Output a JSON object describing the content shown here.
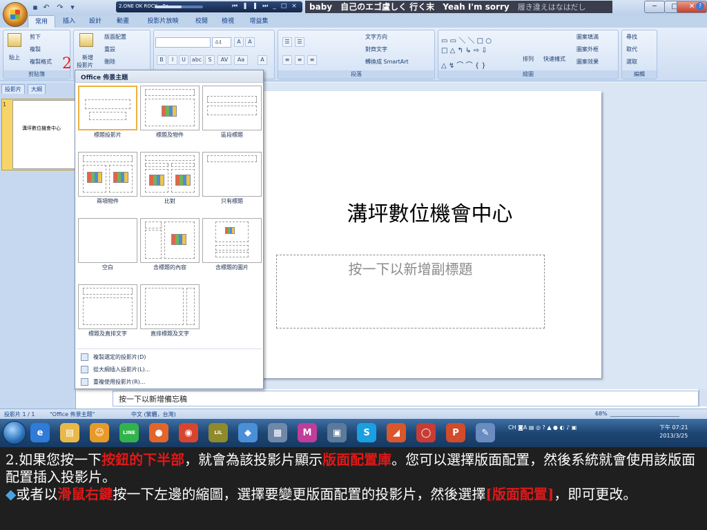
{
  "app": {
    "qat_icons": [
      "save-icon",
      "undo-icon",
      "redo-icon",
      "customize-qat-icon"
    ],
    "media_player": {
      "title": "2.ONE OK ROCK - Re",
      "buttons": [
        "⏮",
        "❚❚",
        "⏭",
        "_",
        "□",
        "×"
      ]
    },
    "lyric": {
      "text": "baby　自己のエゴ盧しく 行く末　Yeah I'm sorry",
      "tail": "履き違えはなはだし"
    },
    "window_buttons": {
      "min": "─",
      "max": "□",
      "close": "✕"
    }
  },
  "tabs": [
    "常用",
    "插入",
    "設計",
    "動畫",
    "投影片放映",
    "校閱",
    "檢視",
    "增益集"
  ],
  "ribbon": {
    "clipboard": {
      "label": "剪貼簿",
      "paste": "貼上",
      "cut": "剪下",
      "copy": "複製",
      "format_painter": "複製格式"
    },
    "slides": {
      "new_slide": "新增",
      "new_slide2": "投影片",
      "layout": "版面配置",
      "reset": "重設",
      "delete": "刪除"
    },
    "font": {
      "size": "44",
      "grow": "A",
      "shrink": "A",
      "bold": "B",
      "italic": "I",
      "underline": "U",
      "strike": "abc",
      "shadow": "S",
      "spacing": "AV",
      "case": "Aa",
      "color": "A"
    },
    "paragraph": {
      "label": "段落",
      "text_direction": "文字方向",
      "align_text": "對齊文字",
      "smartart": "轉換成 SmartArt"
    },
    "drawing": {
      "label": "繪圖",
      "arrange": "排列",
      "quick_styles": "快速樣式",
      "fill": "圖案填滿",
      "outline": "圖案外框",
      "effects": "圖案效果"
    },
    "editing": {
      "label": "編輯",
      "find": "尋找",
      "replace": "取代",
      "select": "選取"
    }
  },
  "annotation_number": "2",
  "left_pane": {
    "tabs": [
      "投影片",
      "大綱"
    ],
    "thumb_number": "1",
    "thumb_text": "溝坪數位機會中心"
  },
  "layout_dropdown": {
    "header": "Office 佈景主題",
    "layouts": [
      "標題投影片",
      "標題及物件",
      "區段標題",
      "兩項物件",
      "比對",
      "只有標題",
      "空白",
      "含標題的內容",
      "含標題的圖片",
      "標題及直排文字",
      "直排標題及文字"
    ],
    "menu": [
      "複製選定的投影片(D)",
      "從大綱插入投影片(L)...",
      "重複使用投影片(R)..."
    ]
  },
  "slide": {
    "title": "溝坪數位機會中心",
    "subtitle": "按一下以新增副標題"
  },
  "notes_placeholder": "按一下以新增備忘稿",
  "status": {
    "slide": "投影片 1 / 1",
    "theme": "\"Office 佈景主題\"",
    "lang": "中文 (繁體，台灣)",
    "zoom": "68%"
  },
  "taskbar": {
    "icons": [
      {
        "name": "ie-icon",
        "glyph": "e",
        "color": "#2f7bd8"
      },
      {
        "name": "explorer-icon",
        "glyph": "▤",
        "color": "#e8b94a"
      },
      {
        "name": "chat-icon",
        "glyph": "☺",
        "color": "#e89a28"
      },
      {
        "name": "line-icon",
        "glyph": "LINE",
        "color": "#33b44a"
      },
      {
        "name": "firefox-icon",
        "glyph": "●",
        "color": "#e2662a"
      },
      {
        "name": "chrome-icon",
        "glyph": "◉",
        "color": "#d8452f"
      },
      {
        "name": "lrc-icon",
        "glyph": "LiL",
        "color": "#8f8a2c"
      },
      {
        "name": "folder-icon",
        "glyph": "◆",
        "color": "#4a90d8"
      },
      {
        "name": "calculator-icon",
        "glyph": "▦",
        "color": "#6f88aa"
      },
      {
        "name": "media-icon",
        "glyph": "M",
        "color": "#c03d99"
      },
      {
        "name": "network-icon",
        "glyph": "▣",
        "color": "#5c7a9a"
      },
      {
        "name": "skype-icon",
        "glyph": "S",
        "color": "#1aa0e0"
      },
      {
        "name": "slides-icon",
        "glyph": "◢",
        "color": "#d9572c"
      },
      {
        "name": "player-icon",
        "glyph": "◯",
        "color": "#c83c34"
      },
      {
        "name": "powerpoint-icon",
        "glyph": "P",
        "color": "#d24b2b"
      },
      {
        "name": "paint-icon",
        "glyph": "✎",
        "color": "#6a8cc0"
      }
    ],
    "tray": "CH ◙A ▤ ◎ ? ▲ ● ◐ ♪ ▣",
    "time": "下午 07:21",
    "date": "2013/3/25"
  },
  "caption": {
    "line1_pre": "2.如果您按一下",
    "line1_red": "按鈕的下半部",
    "line1_mid": "，就會為該投影片顯示",
    "line1_red2": "版面配置庫",
    "line1_post": "。您可以選擇版面配置，然後系統就會使用該版面配置插入投影片。",
    "bullet": "◆",
    "line2_pre": "或者以",
    "line2_red": "滑鼠右鍵",
    "line2_mid": "按一下左邊的縮圖，選擇要變更版面配置的投影片，然後選擇",
    "line2_red2": "[版面配置]",
    "line2_post": "，即可更改。"
  }
}
